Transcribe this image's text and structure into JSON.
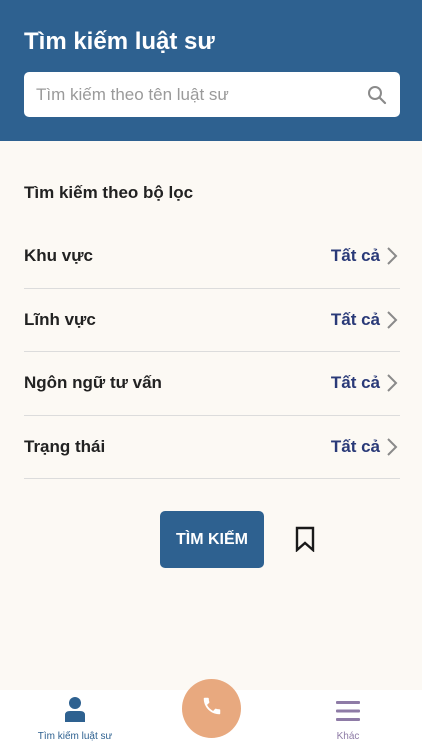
{
  "header": {
    "title": "Tìm kiếm luật sư",
    "search_placeholder": "Tìm kiếm theo tên luật sư",
    "search_icon": "search-icon"
  },
  "filters": {
    "section_title": "Tìm kiếm theo bộ lọc",
    "items": [
      {
        "label": "Khu vực",
        "value": "Tất cả"
      },
      {
        "label": "Lĩnh vực",
        "value": "Tất cả"
      },
      {
        "label": "Ngôn ngữ tư vấn",
        "value": "Tất cả"
      },
      {
        "label": "Trạng thái",
        "value": "Tất cả"
      }
    ]
  },
  "actions": {
    "search_label": "TÌM KIẾM",
    "bookmark_icon": "bookmark-icon"
  },
  "bottom_nav": {
    "items": [
      {
        "label": "Tìm kiếm luật sư",
        "icon": "person-icon",
        "active": true
      },
      {
        "label": "Khác",
        "icon": "menu-icon",
        "active": false
      }
    ],
    "call_icon": "phone-icon"
  },
  "colors": {
    "primary": "#2e6190",
    "accent_value": "#2a3a78",
    "call_button": "#e8a97f",
    "background": "#fcf9f4",
    "inactive_nav": "#8e7ba6"
  }
}
